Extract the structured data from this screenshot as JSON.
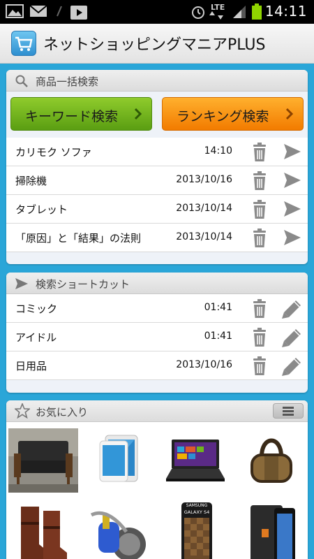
{
  "status": {
    "time": "14:11",
    "network": "LTE"
  },
  "app": {
    "title": "ネットショッピングマニアPLUS"
  },
  "search_panel": {
    "header": "商品一括検索",
    "keyword_button": "キーワード検索",
    "ranking_button": "ランキング検索",
    "rows": [
      {
        "label": "カリモク ソファ",
        "date": "14:10"
      },
      {
        "label": "掃除機",
        "date": "2013/10/16"
      },
      {
        "label": "タブレット",
        "date": "2013/10/14"
      },
      {
        "label": "「原因」と「結果」の法則",
        "date": "2013/10/14"
      }
    ]
  },
  "shortcut_panel": {
    "header": "検索ショートカット",
    "rows": [
      {
        "label": "コミック",
        "date": "01:41"
      },
      {
        "label": "アイドル",
        "date": "01:41"
      },
      {
        "label": "日用品",
        "date": "2013/10/16"
      }
    ]
  },
  "favorites_panel": {
    "header": "お気に入り",
    "tablet_brand": "SAMSUNG",
    "tablet_model": "GALAXY S4"
  },
  "colors": {
    "background": "#2aa6d8",
    "keyword_button": "#6fb51c",
    "ranking_button": "#f78f0f"
  }
}
